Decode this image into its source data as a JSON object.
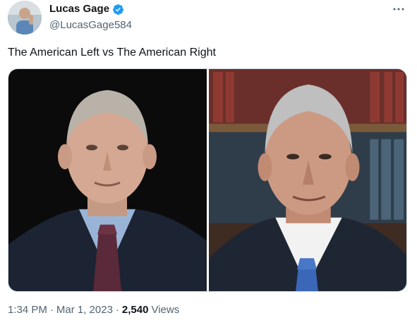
{
  "author": {
    "name": "Lucas Gage",
    "handle": "@LucasGage584",
    "verified_color": "#1d9bf0"
  },
  "more_icon": "more-dots-icon",
  "tweet": {
    "text": "The American Left vs The American Right"
  },
  "media": {
    "photos": [
      {
        "label": "left-photo"
      },
      {
        "label": "right-photo"
      }
    ]
  },
  "meta": {
    "time": "1:34 PM",
    "date": "Mar 1, 2023",
    "separator": "·",
    "views_count": "2,540",
    "views_label": "Views"
  },
  "colors": {
    "text_primary": "#0f1419",
    "text_secondary": "#536471",
    "border": "#cfd9de",
    "accent": "#1d9bf0"
  }
}
